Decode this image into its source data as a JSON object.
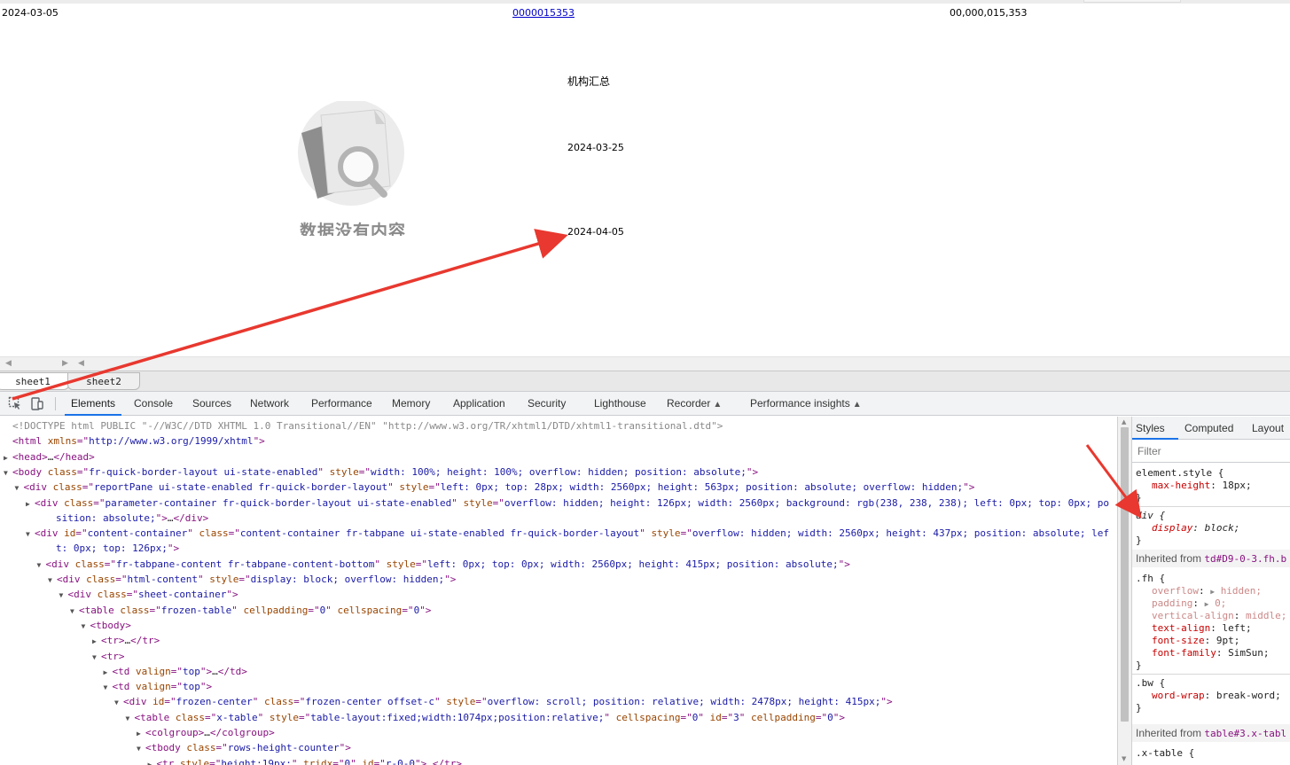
{
  "report": {
    "cells": [
      {
        "text": "2024-03-05"
      },
      {
        "text": "0000015353",
        "link": true
      },
      {
        "text": "00,000,015,353"
      },
      {
        "text": "机构汇总"
      },
      {
        "text": "2024-03-25"
      },
      {
        "text": "2024-04-05"
      }
    ],
    "empty_state_text": "数据没有内容"
  },
  "sheet_tabs": [
    {
      "label": "sheet1",
      "active": true
    },
    {
      "label": "sheet2",
      "active": false
    }
  ],
  "devtools": {
    "tabs": [
      {
        "label": "Elements",
        "active": true
      },
      {
        "label": "Console"
      },
      {
        "label": "Sources"
      },
      {
        "label": "Network"
      },
      {
        "label": "Performance"
      },
      {
        "label": "Memory"
      },
      {
        "label": "Application"
      },
      {
        "label": "Security"
      },
      {
        "label": "Lighthouse"
      },
      {
        "label": "Recorder",
        "flask": true
      },
      {
        "label": "Performance insights",
        "flask": true
      }
    ],
    "dom_lines": [
      {
        "indent": 0,
        "tri": "",
        "parts": [
          [
            "cm",
            "<!DOCTYPE html PUBLIC \"-//W3C//DTD XHTML 1.0 Transitional//EN\" \"http://www.w3.org/TR/xhtml1/DTD/xhtml1-transitional.dtd\">"
          ]
        ]
      },
      {
        "indent": 0,
        "tri": "",
        "parts": [
          [
            "tg",
            "<html "
          ],
          [
            "an",
            "xmlns"
          ],
          [
            "tg",
            "=\""
          ],
          [
            "av",
            "http://www.w3.org/1999/xhtml"
          ],
          [
            "tg",
            "\">"
          ]
        ]
      },
      {
        "indent": 0,
        "tri": "right",
        "parts": [
          [
            "tg",
            "<head>"
          ],
          [
            "tx",
            "…"
          ],
          [
            "tg",
            "</head>"
          ]
        ]
      },
      {
        "indent": 0,
        "tri": "down",
        "parts": [
          [
            "tg",
            "<body "
          ],
          [
            "an",
            "class"
          ],
          [
            "tg",
            "=\""
          ],
          [
            "av",
            "fr-quick-border-layout ui-state-enabled"
          ],
          [
            "tg",
            "\" "
          ],
          [
            "an",
            "style"
          ],
          [
            "tg",
            "=\""
          ],
          [
            "av",
            "width: 100%; height: 100%; overflow: hidden; position: absolute;"
          ],
          [
            "tg",
            "\">"
          ]
        ]
      },
      {
        "indent": 1,
        "tri": "down",
        "parts": [
          [
            "tg",
            "<div "
          ],
          [
            "an",
            "class"
          ],
          [
            "tg",
            "=\""
          ],
          [
            "av",
            "reportPane ui-state-enabled fr-quick-border-layout"
          ],
          [
            "tg",
            "\" "
          ],
          [
            "an",
            "style"
          ],
          [
            "tg",
            "=\""
          ],
          [
            "av",
            "left: 0px; top: 28px; width: 2560px; height: 563px; position: absolute; overflow: hidden;"
          ],
          [
            "tg",
            "\">"
          ]
        ]
      },
      {
        "indent": 2,
        "tri": "right",
        "parts": [
          [
            "tg",
            "<div "
          ],
          [
            "an",
            "class"
          ],
          [
            "tg",
            "=\""
          ],
          [
            "av",
            "parameter-container fr-quick-border-layout ui-state-enabled"
          ],
          [
            "tg",
            "\" "
          ],
          [
            "an",
            "style"
          ],
          [
            "tg",
            "=\""
          ],
          [
            "av",
            "overflow: hidden; height: 126px; width: 2560px; background: rgb(238, 238, 238); left: 0px; top: 0px; po"
          ]
        ]
      },
      {
        "indent": 2,
        "tri": "",
        "cont": true,
        "parts": [
          [
            "av",
            "sition: absolute;"
          ],
          [
            "tg",
            "\">"
          ],
          [
            "tx",
            "…"
          ],
          [
            "tg",
            "</div>"
          ]
        ]
      },
      {
        "indent": 2,
        "tri": "down",
        "parts": [
          [
            "tg",
            "<div "
          ],
          [
            "an",
            "id"
          ],
          [
            "tg",
            "=\""
          ],
          [
            "av",
            "content-container"
          ],
          [
            "tg",
            "\" "
          ],
          [
            "an",
            "class"
          ],
          [
            "tg",
            "=\""
          ],
          [
            "av",
            "content-container fr-tabpane ui-state-enabled fr-quick-border-layout"
          ],
          [
            "tg",
            "\" "
          ],
          [
            "an",
            "style"
          ],
          [
            "tg",
            "=\""
          ],
          [
            "av",
            "overflow: hidden; width: 2560px; height: 437px; position: absolute; lef"
          ]
        ]
      },
      {
        "indent": 2,
        "tri": "",
        "cont": true,
        "parts": [
          [
            "av",
            "t: 0px; top: 126px;"
          ],
          [
            "tg",
            "\">"
          ]
        ]
      },
      {
        "indent": 3,
        "tri": "down",
        "parts": [
          [
            "tg",
            "<div "
          ],
          [
            "an",
            "class"
          ],
          [
            "tg",
            "=\""
          ],
          [
            "av",
            "fr-tabpane-content fr-tabpane-content-bottom"
          ],
          [
            "tg",
            "\" "
          ],
          [
            "an",
            "style"
          ],
          [
            "tg",
            "=\""
          ],
          [
            "av",
            "left: 0px; top: 0px; width: 2560px; height: 415px; position: absolute;"
          ],
          [
            "tg",
            "\">"
          ]
        ]
      },
      {
        "indent": 4,
        "tri": "down",
        "parts": [
          [
            "tg",
            "<div "
          ],
          [
            "an",
            "class"
          ],
          [
            "tg",
            "=\""
          ],
          [
            "av",
            "html-content"
          ],
          [
            "tg",
            "\" "
          ],
          [
            "an",
            "style"
          ],
          [
            "tg",
            "=\""
          ],
          [
            "av",
            "display: block; overflow: hidden;"
          ],
          [
            "tg",
            "\">"
          ]
        ]
      },
      {
        "indent": 5,
        "tri": "down",
        "parts": [
          [
            "tg",
            "<div "
          ],
          [
            "an",
            "class"
          ],
          [
            "tg",
            "=\""
          ],
          [
            "av",
            "sheet-container"
          ],
          [
            "tg",
            "\">"
          ]
        ]
      },
      {
        "indent": 6,
        "tri": "down",
        "parts": [
          [
            "tg",
            "<table "
          ],
          [
            "an",
            "class"
          ],
          [
            "tg",
            "=\""
          ],
          [
            "av",
            "frozen-table"
          ],
          [
            "tg",
            "\" "
          ],
          [
            "an",
            "cellpadding"
          ],
          [
            "tg",
            "=\""
          ],
          [
            "av",
            "0"
          ],
          [
            "tg",
            "\" "
          ],
          [
            "an",
            "cellspacing"
          ],
          [
            "tg",
            "=\""
          ],
          [
            "av",
            "0"
          ],
          [
            "tg",
            "\">"
          ]
        ]
      },
      {
        "indent": 7,
        "tri": "down",
        "parts": [
          [
            "tg",
            "<tbody>"
          ]
        ]
      },
      {
        "indent": 8,
        "tri": "right",
        "parts": [
          [
            "tg",
            "<tr>"
          ],
          [
            "tx",
            "…"
          ],
          [
            "tg",
            "</tr>"
          ]
        ]
      },
      {
        "indent": 8,
        "tri": "down",
        "parts": [
          [
            "tg",
            "<tr>"
          ]
        ]
      },
      {
        "indent": 9,
        "tri": "right",
        "parts": [
          [
            "tg",
            "<td "
          ],
          [
            "an",
            "valign"
          ],
          [
            "tg",
            "=\""
          ],
          [
            "av",
            "top"
          ],
          [
            "tg",
            "\">"
          ],
          [
            "tx",
            "…"
          ],
          [
            "tg",
            "</td>"
          ]
        ]
      },
      {
        "indent": 9,
        "tri": "down",
        "parts": [
          [
            "tg",
            "<td "
          ],
          [
            "an",
            "valign"
          ],
          [
            "tg",
            "=\""
          ],
          [
            "av",
            "top"
          ],
          [
            "tg",
            "\">"
          ]
        ]
      },
      {
        "indent": 10,
        "tri": "down",
        "parts": [
          [
            "tg",
            "<div "
          ],
          [
            "an",
            "id"
          ],
          [
            "tg",
            "=\""
          ],
          [
            "av",
            "frozen-center"
          ],
          [
            "tg",
            "\" "
          ],
          [
            "an",
            "class"
          ],
          [
            "tg",
            "=\""
          ],
          [
            "av",
            "frozen-center offset-c"
          ],
          [
            "tg",
            "\" "
          ],
          [
            "an",
            "style"
          ],
          [
            "tg",
            "=\""
          ],
          [
            "av",
            "overflow: scroll; position: relative; width: 2478px; height: 415px;"
          ],
          [
            "tg",
            "\">"
          ]
        ]
      },
      {
        "indent": 11,
        "tri": "down",
        "parts": [
          [
            "tg",
            "<table "
          ],
          [
            "an",
            "class"
          ],
          [
            "tg",
            "=\""
          ],
          [
            "av",
            "x-table"
          ],
          [
            "tg",
            "\" "
          ],
          [
            "an",
            "style"
          ],
          [
            "tg",
            "=\""
          ],
          [
            "av",
            "table-layout:fixed;width:1074px;position:relative;"
          ],
          [
            "tg",
            "\" "
          ],
          [
            "an",
            "cellspacing"
          ],
          [
            "tg",
            "=\""
          ],
          [
            "av",
            "0"
          ],
          [
            "tg",
            "\" "
          ],
          [
            "an",
            "id"
          ],
          [
            "tg",
            "=\""
          ],
          [
            "av",
            "3"
          ],
          [
            "tg",
            "\" "
          ],
          [
            "an",
            "cellpadding"
          ],
          [
            "tg",
            "=\""
          ],
          [
            "av",
            "0"
          ],
          [
            "tg",
            "\">"
          ]
        ]
      },
      {
        "indent": 12,
        "tri": "right",
        "parts": [
          [
            "tg",
            "<colgroup>"
          ],
          [
            "tx",
            "…"
          ],
          [
            "tg",
            "</colgroup>"
          ]
        ]
      },
      {
        "indent": 12,
        "tri": "down",
        "parts": [
          [
            "tg",
            "<tbody "
          ],
          [
            "an",
            "class"
          ],
          [
            "tg",
            "=\""
          ],
          [
            "av",
            "rows-height-counter"
          ],
          [
            "tg",
            "\">"
          ]
        ]
      },
      {
        "indent": 13,
        "tri": "right",
        "parts": [
          [
            "tg",
            "<tr "
          ],
          [
            "an",
            "style"
          ],
          [
            "tg",
            "=\""
          ],
          [
            "av",
            "height:19px;"
          ],
          [
            "tg",
            "\" "
          ],
          [
            "an",
            "tridx"
          ],
          [
            "tg",
            "=\""
          ],
          [
            "av",
            "0"
          ],
          [
            "tg",
            "\" "
          ],
          [
            "an",
            "id"
          ],
          [
            "tg",
            "=\""
          ],
          [
            "av",
            "r-0-0"
          ],
          [
            "tg",
            "\">"
          ],
          [
            "tx",
            "…"
          ],
          [
            "tg",
            "</tr>"
          ]
        ]
      }
    ],
    "styles": {
      "tabs": [
        "Styles",
        "Computed",
        "Layout"
      ],
      "filter_placeholder": "Filter",
      "element_style": {
        "selector": "element.style {",
        "prop": "max-height",
        "value": "18px;"
      },
      "div_rule": {
        "selector": "div {",
        "prop": "display",
        "value": "block;"
      },
      "inherited1": {
        "label": "Inherited from ",
        "selector": "td#D9-0-3.fh.b"
      },
      "fh_rule": {
        "selector": ".fh {",
        "props": [
          {
            "prop": "overflow",
            "value": "hidden;",
            "dim": true
          },
          {
            "prop": "padding",
            "value": "0;",
            "dim": true
          },
          {
            "prop": "vertical-align",
            "value": "middle;",
            "dim": true
          },
          {
            "prop": "text-align",
            "value": "left;"
          },
          {
            "prop": "font-size",
            "value": "9pt;"
          },
          {
            "prop": "font-family",
            "value": "SimSun;"
          }
        ]
      },
      "bw_rule": {
        "selector": ".bw {",
        "prop": "word-wrap",
        "value": "break-word;"
      },
      "inherited2": {
        "label": "Inherited from ",
        "selector": "table#3.x-tabl"
      },
      "xtable_rule": {
        "selector": ".x-table {"
      },
      "close_brace": "}"
    }
  }
}
